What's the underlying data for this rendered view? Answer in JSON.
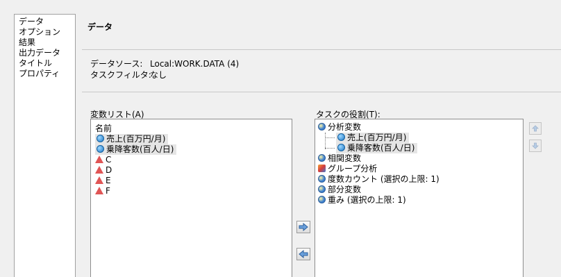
{
  "nav": {
    "items": [
      "データ",
      "オプション",
      "結果",
      "出力データ",
      "タイトル",
      "プロパティ"
    ]
  },
  "section": {
    "title": "データ"
  },
  "info": {
    "source_label": "データソース:",
    "source_value": "Local:WORK.DATA (4)",
    "filter_label": "タスクフィルタ:",
    "filter_value": "なし"
  },
  "variables": {
    "label": "変数リスト(A)",
    "header": "名前",
    "items": [
      {
        "name": "売上(百万円/月)",
        "type": "numeric"
      },
      {
        "name": "乗降客数(百人/日)",
        "type": "numeric"
      },
      {
        "name": "C",
        "type": "character"
      },
      {
        "name": "D",
        "type": "character"
      },
      {
        "name": "E",
        "type": "character"
      },
      {
        "name": "F",
        "type": "character"
      }
    ]
  },
  "roles": {
    "label": "タスクの役割(T):",
    "analysis": "分析変数",
    "analysis_children": [
      "売上(百万円/月)",
      "乗降客数(百人/日)"
    ],
    "others": [
      "相関変数",
      "グループ分析",
      "度数カウント (選択の上限: 1)",
      "部分変数",
      "重み (選択の上限: 1)"
    ]
  },
  "icons": {
    "numeric": "numeric-variable-icon",
    "character": "character-variable-icon",
    "role": "role-icon",
    "group": "group-analysis-icon",
    "add": "arrow-right-icon",
    "remove": "arrow-left-icon",
    "up": "arrow-up-icon",
    "down": "arrow-down-icon"
  },
  "colors": {
    "background": "#f0f0f0",
    "numeric_icon": "#1a78c8",
    "character_icon": "#e05555",
    "selection": "#e5e5e5"
  }
}
